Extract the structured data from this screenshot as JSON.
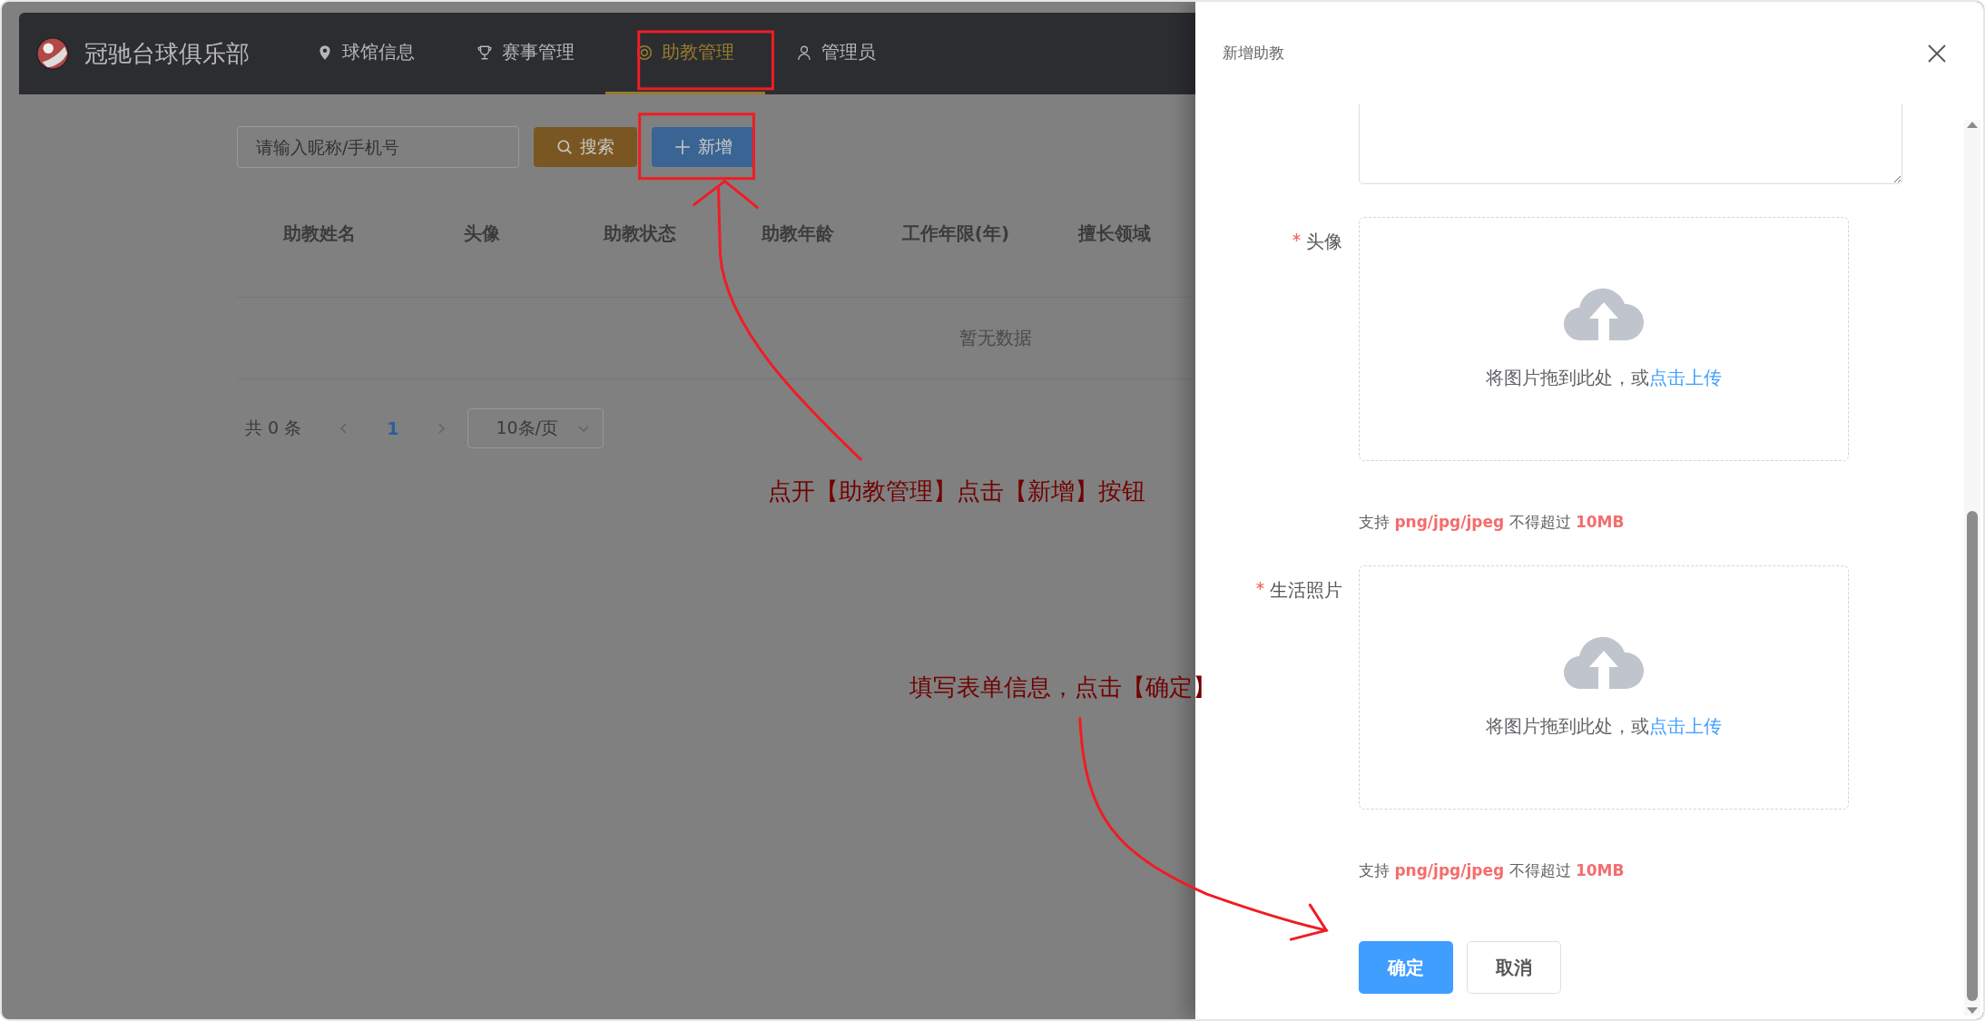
{
  "app": {
    "brand": "冠驰台球俱乐部",
    "nav": [
      {
        "label": "球馆信息",
        "kind": "pin",
        "selected": false
      },
      {
        "label": "赛事管理",
        "kind": "trophy",
        "selected": false
      },
      {
        "label": "助教管理",
        "kind": "ring",
        "selected": true
      },
      {
        "label": "管理员",
        "kind": "user",
        "selected": false
      }
    ],
    "search": {
      "placeholder": "请输入昵称/手机号"
    },
    "search_button": "搜索",
    "add_button": "新增",
    "table": {
      "columns": [
        "助教姓名",
        "头像",
        "助教状态",
        "助教年龄",
        "工作年限(年)",
        "擅长领域"
      ],
      "empty_text": "暂无数据"
    },
    "pagination": {
      "total": "共 0 条",
      "pages": [
        {
          "label": "1",
          "selected": true
        }
      ],
      "page_size": "10条/页"
    }
  },
  "drawer": {
    "title": "新增助教",
    "fields": [
      {
        "kind": "textarea"
      },
      {
        "kind": "upload",
        "label": "头像",
        "required": true,
        "hint": "将图片拖到此处，或",
        "link": "点击上传",
        "tip": "支持 **png/jpg/jpeg** 不得超过 **10MB**"
      },
      {
        "kind": "upload",
        "label": "生活照片",
        "required": true,
        "hint": "将图片拖到此处，或",
        "link": "点击上传",
        "tip": "支持 **png/jpg/jpeg** 不得超过 **10MB**"
      }
    ],
    "buttons": [
      {
        "label": "确定",
        "kind": "primary"
      },
      {
        "label": "取消",
        "kind": "default"
      }
    ]
  },
  "annotations": [
    {
      "text": "点开【助教管理】点击【新增】按钮"
    },
    {
      "text": "填写表单信息，点击【确定】"
    }
  ]
}
